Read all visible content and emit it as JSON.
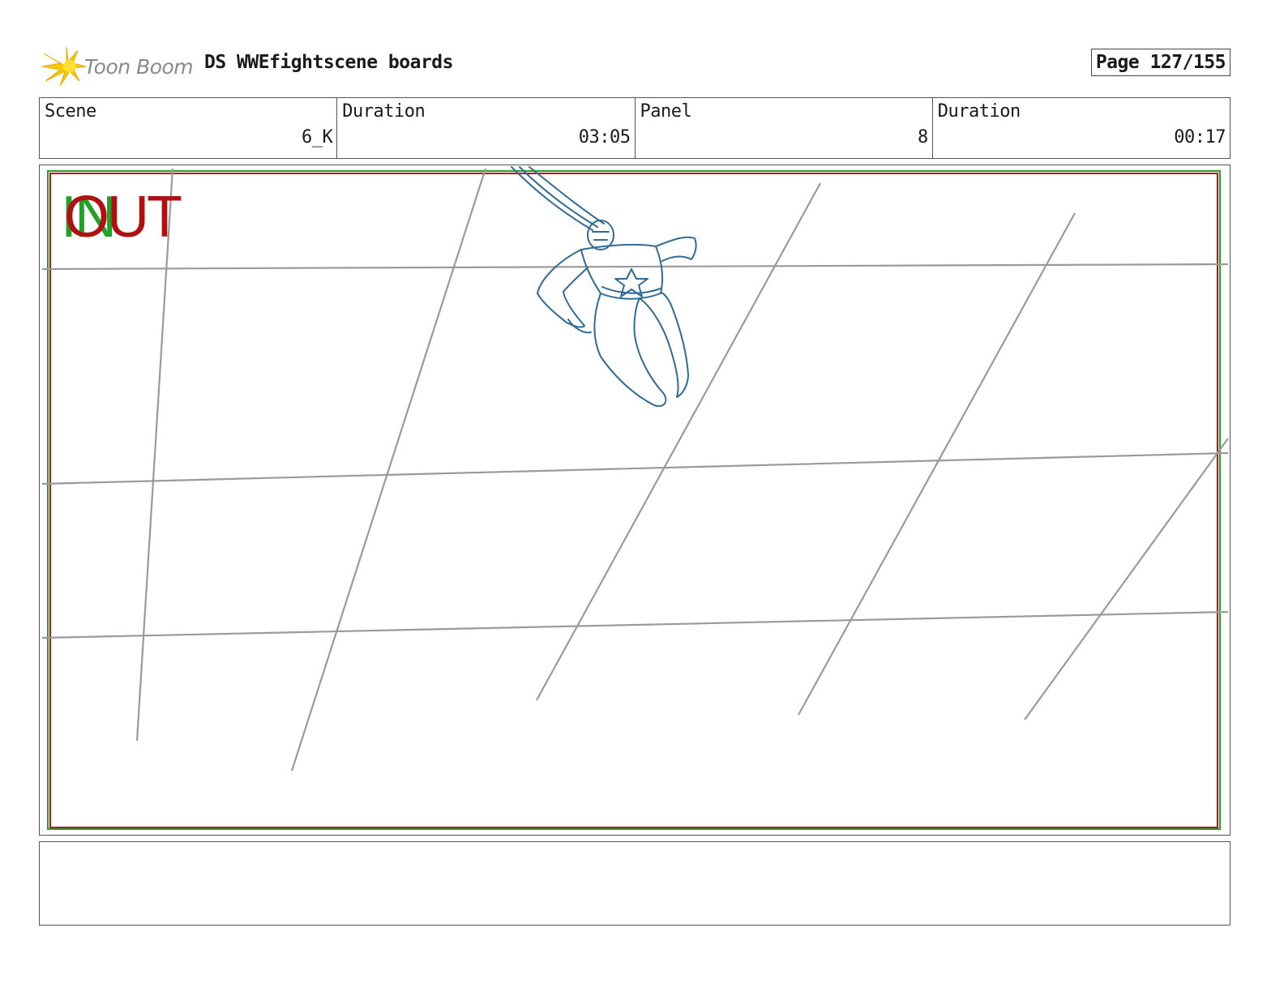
{
  "header": {
    "logo_text": "Toon Boom",
    "title": "DS WWEfightscene boards",
    "page": "Page 127/155"
  },
  "info": {
    "scene_label": "Scene",
    "scene_value": "6_K",
    "duration_label": "Duration",
    "duration_value": "03:05",
    "panel_label": "Panel",
    "panel_value": "8",
    "panel_duration_label": "Duration",
    "panel_duration_value": "00:17"
  },
  "panel_frame": {
    "in_marker": "IN",
    "out_marker": "OUT",
    "safe_area_colors": {
      "green": "#22a02a",
      "red": "#c01010"
    },
    "sketch_color": "#2f6b94",
    "grid_line_color": "#9a9a9a"
  },
  "notes": {
    "text": ""
  },
  "icons": [
    "toon-boom-logo-icon"
  ]
}
